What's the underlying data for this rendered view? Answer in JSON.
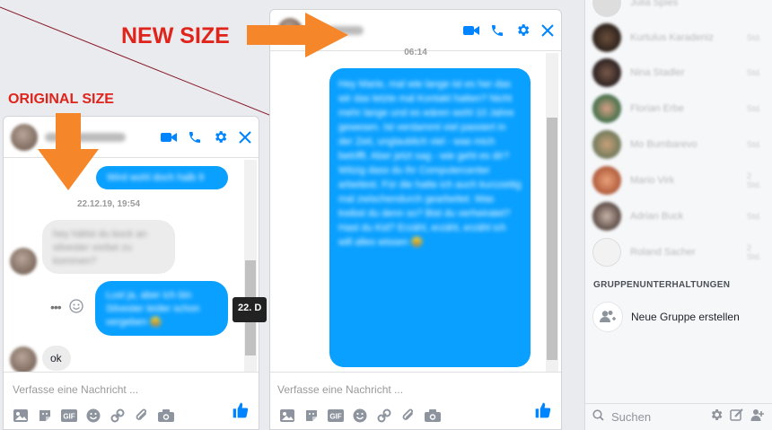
{
  "annotations": {
    "new_size": "NEW SIZE",
    "original_size": "ORIGINAL SIZE"
  },
  "small_chat": {
    "timestamp": "22.12.19, 19:54",
    "msg_sent_1": "Wird wohl doch halb 9",
    "msg_received_1": "hey hättst du bock an silvester vorbei zu kommen?",
    "msg_sent_2": "Lust ja, aber ich bin Silvester leider schon vergeben 😅",
    "msg_received_ok": "ok",
    "tooltip": "22. D",
    "composer_placeholder": "Verfasse eine Nachricht ..."
  },
  "large_chat": {
    "timestamp": "06:14",
    "message": "Hey Marie, mal wie lange ist es her das wir das letzte mal Kontakt hatten? Nicht mehr lange und es wären wohl 10 Jahre gewesen. Ist verdammt viel passiert in der Zeit, unglaublich viel - was mich betrifft. Aber jetzt sag - wie geht es dir? Witzig dass du ihr Computercenter arbeitest. Für die hatte ich auch kurzzeitig mal zwischendurch gearbeitet. Was treibst du denn so? Bist du verheiratet? Hast du Kid? Erzähl, erzähl, erzähl ich will alles wissen 😀",
    "composer_placeholder": "Verfasse eine Nachricht ..."
  },
  "sidebar": {
    "contacts": [
      {
        "name": "Julia Spies",
        "time": ""
      },
      {
        "name": "Kurtulus Karadeniz",
        "time": "Std."
      },
      {
        "name": "Nina Stadler",
        "time": "Std."
      },
      {
        "name": "Florian Erbe",
        "time": "Std."
      },
      {
        "name": "Mo Bumbarevo",
        "time": "Std."
      },
      {
        "name": "Mario Virk",
        "time": "2 Std."
      },
      {
        "name": "Adrian Buck",
        "time": "Std."
      },
      {
        "name": "Roland Sacher",
        "time": "2 Std."
      }
    ],
    "group_section_title": "GRUPPENUNTERHALTUNGEN",
    "new_group_label": "Neue Gruppe erstellen",
    "search_placeholder": "Suchen"
  },
  "colors": {
    "accent": "#0084ff",
    "bubble_blue": "#0aa0ff",
    "annotation_red": "#e0241b",
    "arrow_orange": "#f5862a"
  }
}
